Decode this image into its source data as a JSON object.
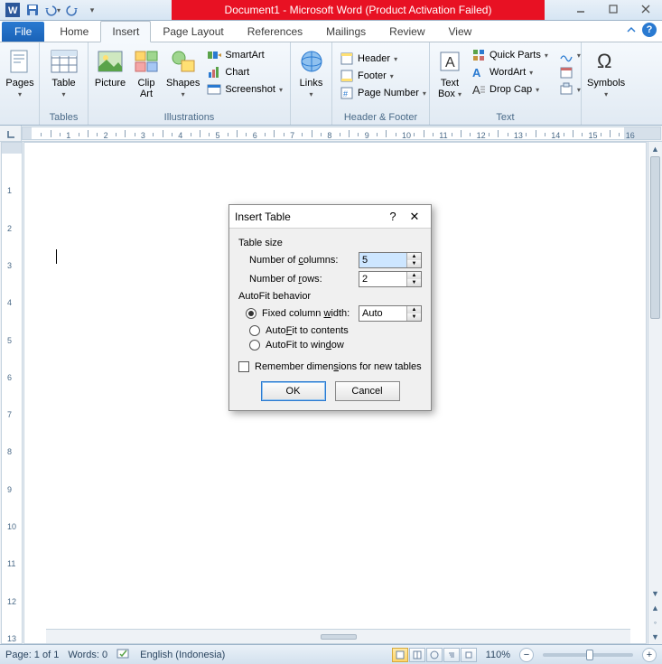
{
  "title": "Document1 - Microsoft Word (Product Activation Failed)",
  "tabs": {
    "file": "File",
    "home": "Home",
    "insert": "Insert",
    "pagelayout": "Page Layout",
    "references": "References",
    "mailings": "Mailings",
    "review": "Review",
    "view": "View"
  },
  "ribbon": {
    "pages": "Pages",
    "tables_group": "Tables",
    "table": "Table",
    "illustrations": "Illustrations",
    "picture": "Picture",
    "clipart": "Clip\nArt",
    "shapes": "Shapes",
    "smartart": "SmartArt",
    "chart": "Chart",
    "screenshot": "Screenshot",
    "links": "Links",
    "headerfooter": "Header & Footer",
    "header": "Header",
    "footer": "Footer",
    "pagenumber": "Page Number",
    "text_group": "Text",
    "textbox": "Text\nBox",
    "quickparts": "Quick Parts",
    "wordart": "WordArt",
    "dropcap": "Drop Cap",
    "symbols_group": "Symbols",
    "symbols": "Symbols"
  },
  "dialog": {
    "title": "Insert Table",
    "tablesize": "Table size",
    "numcols": "Number of columns:",
    "numcols_val": "5",
    "numrows": "Number of rows:",
    "numrows_val": "2",
    "autofit_h": "AutoFit behavior",
    "fixedwidth": "Fixed column width:",
    "fixedwidth_val": "Auto",
    "autofit_contents": "AutoFit to contents",
    "autofit_window": "AutoFit to window",
    "remember": "Remember dimensions for new tables",
    "ok": "OK",
    "cancel": "Cancel"
  },
  "status": {
    "page": "Page: 1 of 1",
    "words": "Words: 0",
    "lang": "English (Indonesia)",
    "zoom": "110%"
  }
}
